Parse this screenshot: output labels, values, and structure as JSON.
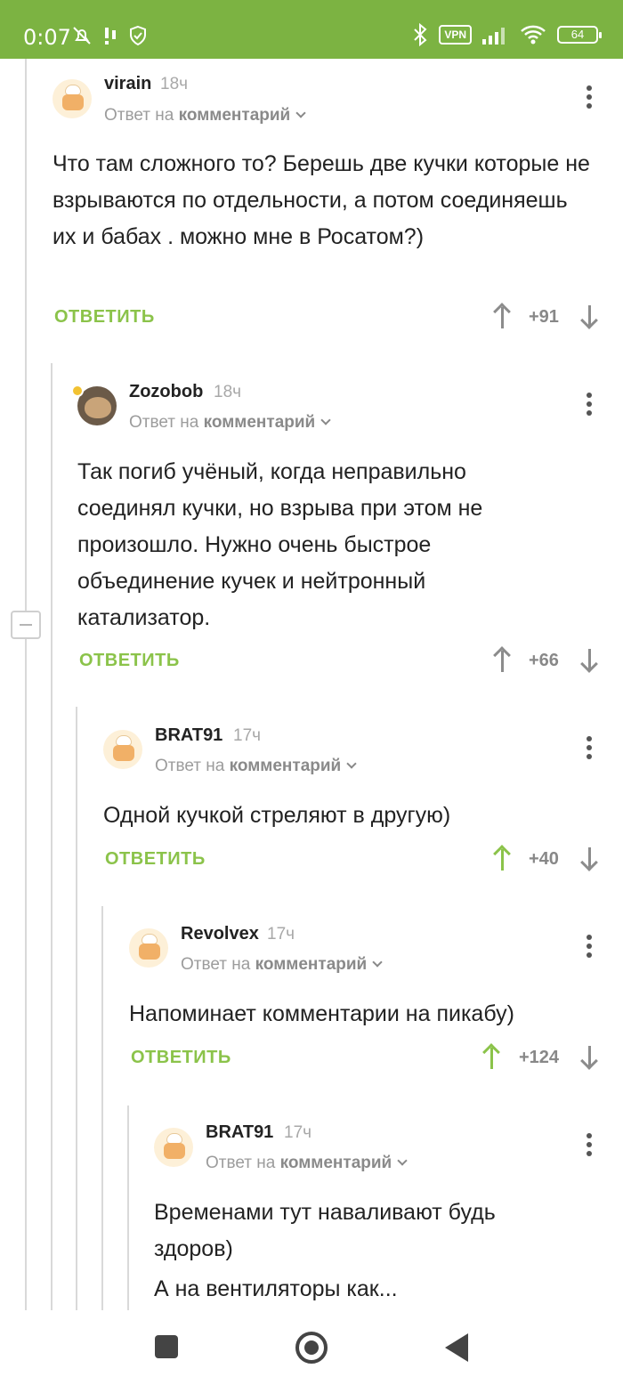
{
  "status_bar": {
    "time": "0:07",
    "vpn": "VPN",
    "battery": "64"
  },
  "comments": [
    {
      "author": "virain",
      "time": "18ч",
      "reply_prefix": "Ответ на",
      "reply_target": "комментарий",
      "text": "Что там сложного то? Берешь две кучки которые не взрываются по отдельности, а потом соединяешь их и бабах . можно мне в Росатом?)",
      "reply_label": "ОТВЕТИТЬ",
      "rating": "+91"
    },
    {
      "author": "Zozobob",
      "time": "18ч",
      "reply_prefix": "Ответ на",
      "reply_target": "комментарий",
      "text": "Так погиб учёный, когда неправильно соединял кучки, но взрыва при этом не произошло. Нужно очень быстрое объединение кучек и нейтронный катализатор.",
      "reply_label": "ОТВЕТИТЬ",
      "rating": "+66"
    },
    {
      "author": "BRAT91",
      "time": "17ч",
      "reply_prefix": "Ответ на",
      "reply_target": "комментарий",
      "text": "Одной кучкой стреляют в другую)",
      "reply_label": "ОТВЕТИТЬ",
      "rating": "+40"
    },
    {
      "author": "Revolvex",
      "time": "17ч",
      "reply_prefix": "Ответ на",
      "reply_target": "комментарий",
      "text": "Напоминает комментарии на пикабу)",
      "reply_label": "ОТВЕТИТЬ",
      "rating": "+124"
    },
    {
      "author": "BRAT91",
      "time": "17ч",
      "reply_prefix": "Ответ на",
      "reply_target": "комментарий",
      "text": "Временами тут наваливают будь здоров)",
      "text2": "А на вентиляторы как..."
    }
  ],
  "colors": {
    "accent": "#8bc34a",
    "status_bar": "#7cb342"
  }
}
